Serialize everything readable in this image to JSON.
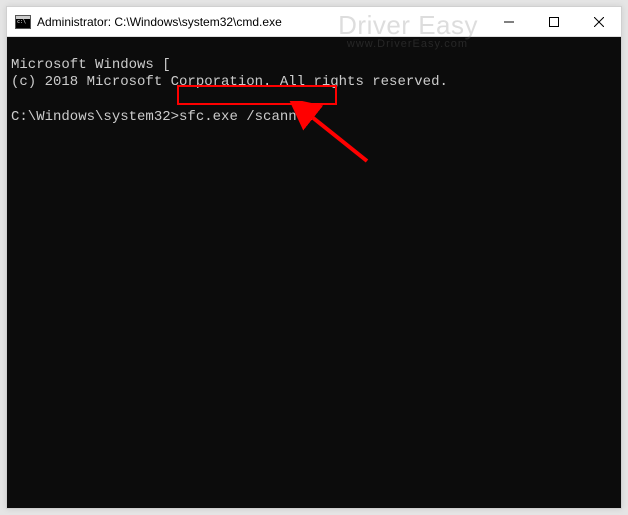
{
  "titlebar": {
    "title": "Administrator: C:\\Windows\\system32\\cmd.exe"
  },
  "console": {
    "line1": "Microsoft Windows [",
    "line2": "(c) 2018 Microsoft Corporation. All rights reserved.",
    "blank": "",
    "prompt": "C:\\Windows\\system32>",
    "command": "sfc.exe /scannow"
  },
  "watermark": {
    "brand": "Driver Easy",
    "url": "www.DriverEasy.com"
  },
  "annotation": {
    "highlight_target": "command",
    "arrow_color": "#ff0000"
  }
}
